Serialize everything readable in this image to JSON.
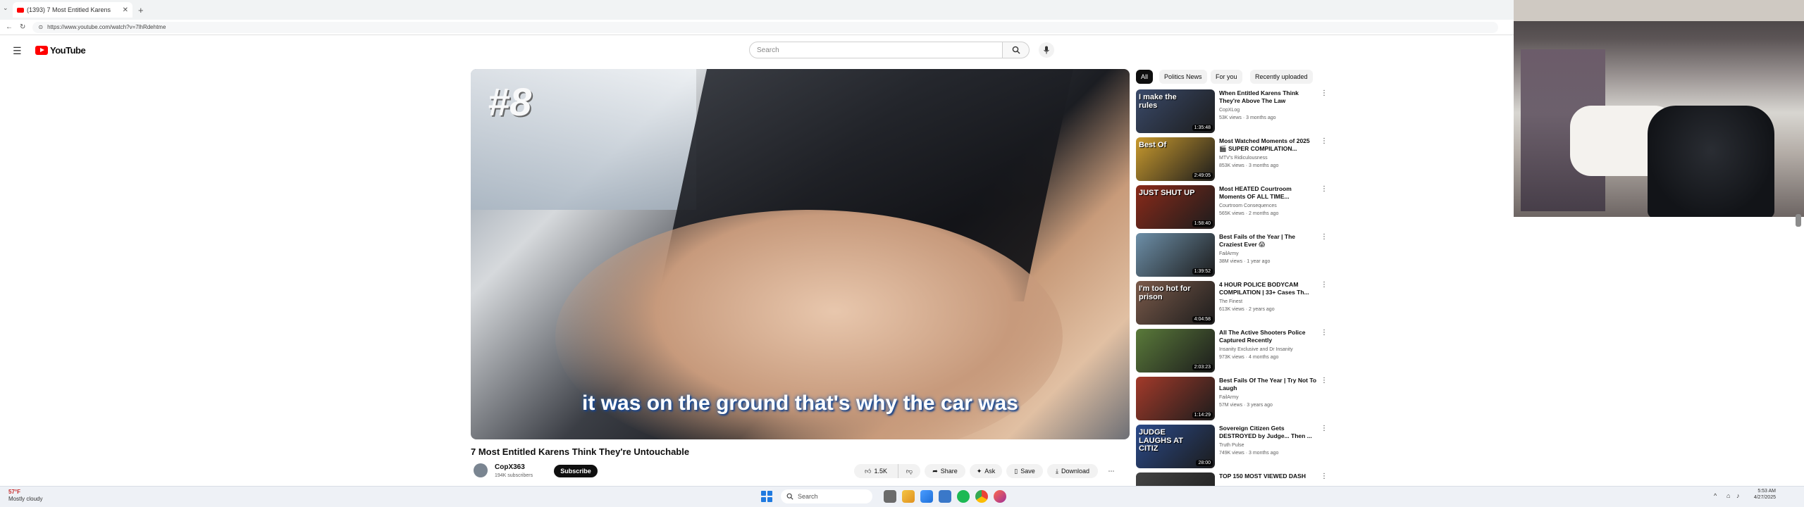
{
  "browser": {
    "tab_title": "(1393) 7 Most Entitled Karens",
    "url": "https://www.youtube.com/watch?v=7lhRdehtme"
  },
  "youtube": {
    "logo_text": "YouTube",
    "search_placeholder": "Search"
  },
  "video": {
    "overlay_number": "#8",
    "caption": "it was on the ground that's why the car was",
    "title": "7 Most Entitled Karens Think They're Untouchable",
    "channel_name": "CopX363",
    "channel_subs": "194K subscribers",
    "subscribe_label": "Subscribe",
    "likes": "1.5K",
    "share_label": "Share",
    "ask_label": "Ask",
    "save_label": "Save",
    "download_label": "Download"
  },
  "chips": [
    "All",
    "Politics News",
    "For you",
    "Recently uploaded"
  ],
  "recommendations": [
    {
      "title": "When Entitled Karens Think They're Above The Law",
      "channel": "CopXLog",
      "meta": "53K views · 3 months ago",
      "duration": "1:35:48",
      "thumb_text": "I make the rules",
      "color": "#3a4a6a"
    },
    {
      "title": "Most Watched Moments of 2025 🎬 SUPER COMPILATION...",
      "channel": "MTV's Ridiculousness",
      "meta": "853K views · 3 months ago",
      "duration": "2:49:05",
      "thumb_text": "Best Of",
      "color": "#c99a2e"
    },
    {
      "title": "Most HEATED Courtroom Moments OF ALL TIME...",
      "channel": "Courtroom Consequences",
      "meta": "565K views · 2 months ago",
      "duration": "1:58:40",
      "thumb_text": "JUST SHUT UP",
      "color": "#8a2a1a"
    },
    {
      "title": "Best Fails of the Year | The Craziest Ever 😱",
      "channel": "FailArmy",
      "meta": "38M views · 1 year ago",
      "duration": "1:39:52",
      "thumb_text": "",
      "color": "#6d8fa8"
    },
    {
      "title": "4 HOUR POLICE BODYCAM COMPILATION | 33+ Cases Th...",
      "channel": "The Finest",
      "meta": "613K views · 2 years ago",
      "duration": "4:04:58",
      "thumb_text": "I'm too hot for prison",
      "color": "#7a5a4a"
    },
    {
      "title": "All The Active Shooters Police Captured Recently",
      "channel": "Insanity Exclusive and Dr Insanity",
      "meta": "973K views · 4 months ago",
      "duration": "2:03:23",
      "thumb_text": "",
      "color": "#5a7a3a"
    },
    {
      "title": "Best Fails Of The Year | Try Not To Laugh",
      "channel": "FailArmy",
      "meta": "57M views · 3 years ago",
      "duration": "1:14:29",
      "thumb_text": "",
      "color": "#a33a2a"
    },
    {
      "title": "Sovereign Citizen Gets DESTROYED by Judge... Then ...",
      "channel": "Truth Pulse",
      "meta": "749K views · 3 months ago",
      "duration": "28:00",
      "thumb_text": "JUDGE LAUGHS AT CITIZ",
      "color": "#2a4a8a"
    },
    {
      "title": "TOP 150 MOST VIEWED DASH",
      "channel": "",
      "meta": "",
      "duration": "",
      "thumb_text": "",
      "color": "#444444"
    }
  ],
  "taskbar": {
    "temp": "57°F",
    "weather": "Mostly cloudy",
    "search_label": "Search",
    "time": "5:53 AM",
    "date": "4/27/2025"
  }
}
